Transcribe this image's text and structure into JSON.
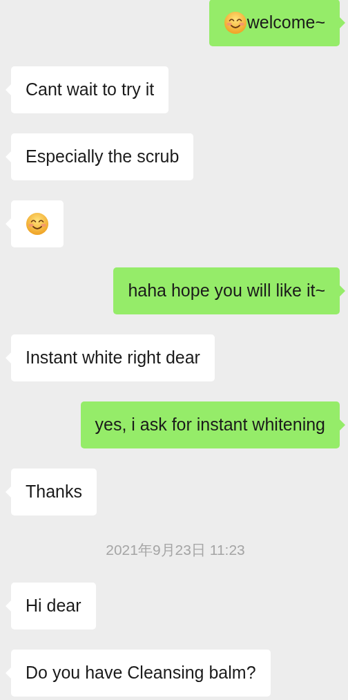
{
  "messages": [
    {
      "kind": "sent",
      "emoji": true,
      "text": "welcome~"
    },
    {
      "kind": "received",
      "emoji": false,
      "text": "Cant wait to try it"
    },
    {
      "kind": "received",
      "emoji": false,
      "text": "Especially the scrub"
    },
    {
      "kind": "received",
      "emoji": true
    },
    {
      "kind": "sent",
      "emoji": false,
      "text": "haha hope you will like it~"
    },
    {
      "kind": "received",
      "emoji": false,
      "text": "Instant white right dear"
    },
    {
      "kind": "sent",
      "emoji": false,
      "text": "yes, i ask for instant whitening"
    },
    {
      "kind": "received",
      "emoji": false,
      "text": "Thanks"
    },
    {
      "kind": "time",
      "text": "2021年9月23日 11:23"
    },
    {
      "kind": "received",
      "emoji": false,
      "text": "Hi dear"
    },
    {
      "kind": "received",
      "emoji": false,
      "text": "Do you have Cleansing balm?"
    }
  ]
}
